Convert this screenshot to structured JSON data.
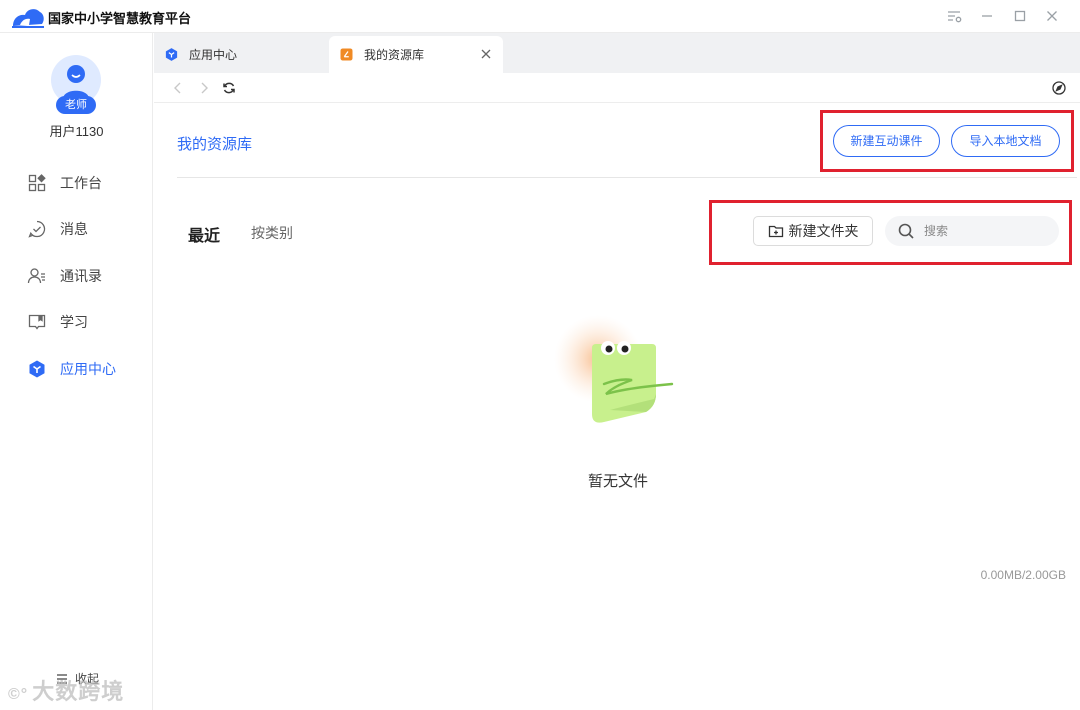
{
  "app": {
    "title": "国家中小学智慧教育平台"
  },
  "user": {
    "role_badge": "老师",
    "name": "用户1130"
  },
  "sidebar": {
    "items": [
      {
        "label": "工作台",
        "icon": "grid-icon"
      },
      {
        "label": "消息",
        "icon": "message-check-icon"
      },
      {
        "label": "通讯录",
        "icon": "contacts-icon"
      },
      {
        "label": "学习",
        "icon": "book-icon"
      },
      {
        "label": "应用中心",
        "icon": "app-center-icon",
        "active": true
      }
    ],
    "collapse_label": "收起"
  },
  "tabs": [
    {
      "label": "应用中心",
      "icon": "app-center-icon",
      "active": false
    },
    {
      "label": "我的资源库",
      "icon": "resource-library-icon",
      "active": true
    }
  ],
  "page": {
    "title": "我的资源库",
    "new_courseware_label": "新建互动课件",
    "import_local_label": "导入本地文档",
    "filter_tabs": {
      "recent": "最近",
      "by_category": "按类别"
    },
    "new_folder_label": "新建文件夹",
    "search_placeholder": "搜索",
    "empty_text": "暂无文件",
    "storage_usage": "0.00MB/2.00GB"
  },
  "watermark": "大数跨境",
  "colors": {
    "accent": "#2f6bf5",
    "highlight_box": "#e0212f"
  }
}
